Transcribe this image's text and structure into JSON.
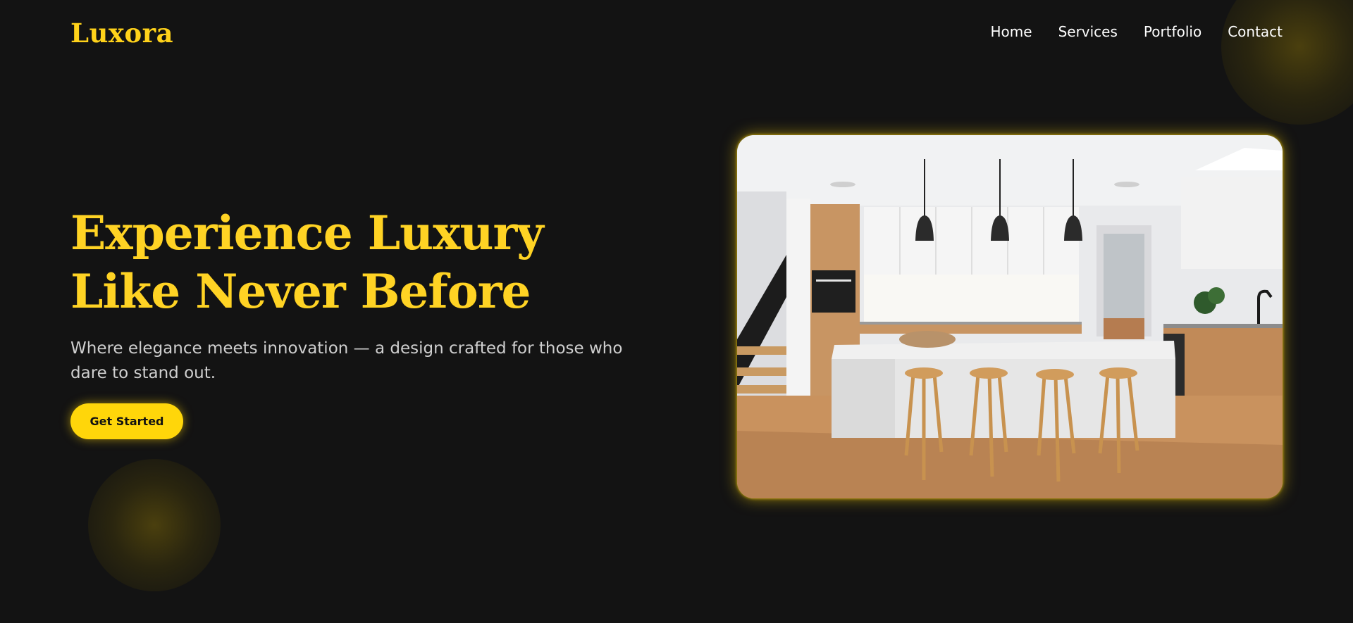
{
  "brand": {
    "logo_text": "Luxora"
  },
  "nav": {
    "items": [
      {
        "label": "Home"
      },
      {
        "label": "Services"
      },
      {
        "label": "Portfolio"
      },
      {
        "label": "Contact"
      }
    ]
  },
  "hero": {
    "title_line1": "Experience Luxury",
    "title_line2": "Like Never Before",
    "subtitle": "Where elegance meets innovation — a design crafted for those who dare to stand out.",
    "cta_label": "Get Started"
  },
  "colors": {
    "background": "#131313",
    "accent": "#ffd21a",
    "text": "#ffffff",
    "muted_text": "#cfcfcf"
  }
}
